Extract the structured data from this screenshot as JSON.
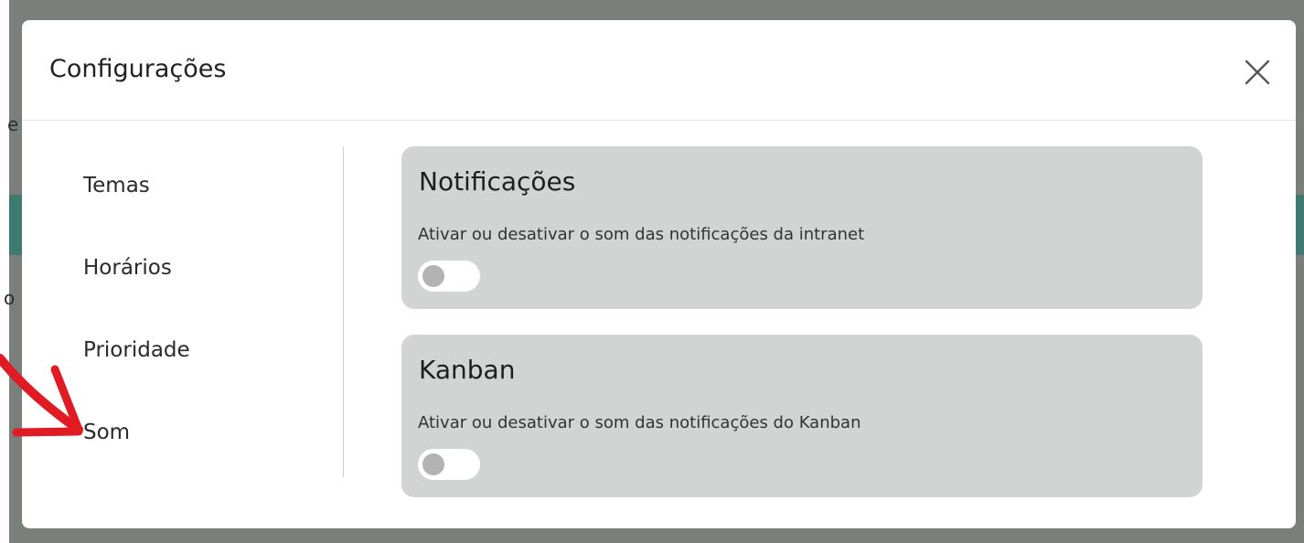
{
  "modal": {
    "title": "Configurações",
    "close_icon": "close-icon"
  },
  "sidebar": {
    "items": [
      {
        "label": "Temas"
      },
      {
        "label": "Horários"
      },
      {
        "label": "Prioridade"
      },
      {
        "label": "Som"
      }
    ]
  },
  "panels": [
    {
      "title": "Notificações",
      "description": "Ativar ou desativar o som das notificações da intranet",
      "toggle_on": false
    },
    {
      "title": "Kanban",
      "description": "Ativar ou desativar o som das notificações do Kanban",
      "toggle_on": false
    }
  ],
  "backdrop": {
    "fragment_1": "e",
    "fragment_2": "o"
  },
  "colors": {
    "backdrop": "#7a7f7c",
    "panel": "#d2d3d3",
    "teal": "#3f7a70",
    "annotation": "#e01b24"
  }
}
